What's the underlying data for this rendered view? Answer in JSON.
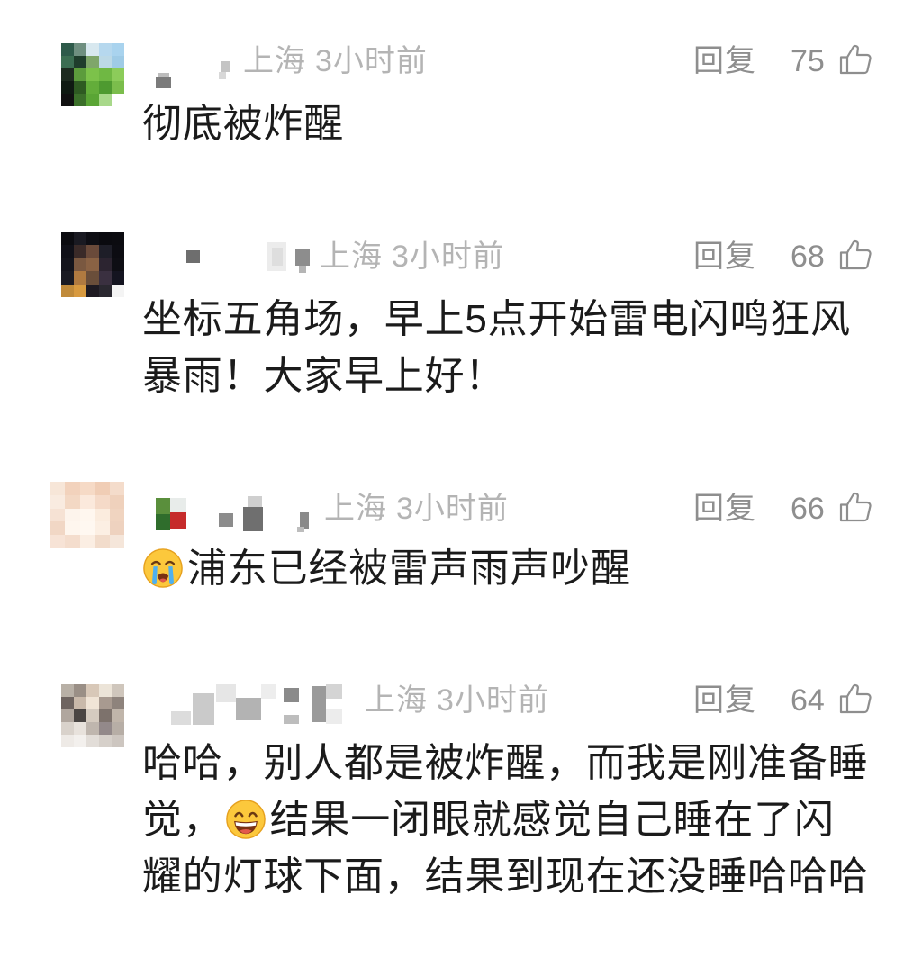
{
  "colors": {
    "text": "#1b1b1b",
    "meta": "#b4b4b4",
    "action": "#8e8e8e",
    "background": "#ffffff"
  },
  "comments": [
    {
      "avatar_colors": [
        "#2e5a4a",
        "#6f8f80",
        "#d8e8ef",
        "#b6d8ee",
        "#a9d3ee",
        "#3c6e52",
        "#1f3d2c",
        "#7fa66a",
        "#bcd9e6",
        "#9fcbe6",
        "#1d2b1f",
        "#5c9c3c",
        "#7cc24a",
        "#6fb843",
        "#8ccc5a",
        "#0f1a12",
        "#2e5a22",
        "#63ad3a",
        "#4e9a30",
        "#7bbd4c",
        "#111111",
        "#3b6f2a",
        "#5aa535",
        "#a8d88a",
        "#ffffff"
      ],
      "location": "上海",
      "time": "3小时前",
      "reply_label": "回复",
      "likes": "75",
      "like_icon": "thumbs-up-icon",
      "lines": [
        [
          {
            "text": "彻底被炸醒"
          }
        ]
      ]
    },
    {
      "avatar_colors": [
        "#0b0b10",
        "#1a1a22",
        "#0e0e14",
        "#0a0a0f",
        "#0b0b10",
        "#101018",
        "#3a2a28",
        "#6a4a3a",
        "#1e1e28",
        "#0c0c12",
        "#14141c",
        "#7a5840",
        "#8a6244",
        "#2c2430",
        "#0e0e14",
        "#1a1a22",
        "#b07a40",
        "#6a4e3a",
        "#3a3040",
        "#141420",
        "#c08a3a",
        "#d89a40",
        "#1e1a22",
        "#2a2830",
        "#f4f4f4"
      ],
      "location": "上海",
      "time": "3小时前",
      "reply_label": "回复",
      "likes": "68",
      "like_icon": "thumbs-up-icon",
      "lines": [
        [
          {
            "text": "坐标五角场，早上5点开始雷电闪鸣狂风"
          }
        ],
        [
          {
            "text": "暴雨！大家早上好！"
          }
        ]
      ]
    },
    {
      "avatar_colors": [
        "#f7e6d8",
        "#f2d2bc",
        "#f6dac6",
        "#f0cdb5",
        "#f4dccb",
        "#f9ebe0",
        "#f3d8c4",
        "#fbe9dc",
        "#f5dac8",
        "#efd1bc",
        "#f6e2d4",
        "#fdf4ec",
        "#fff7ef",
        "#fbecde",
        "#f0d4c0",
        "#f1d7c5",
        "#fef6ee",
        "#fff8f1",
        "#fcefe3",
        "#eed2bf",
        "#f7e3d6",
        "#f4ddcd",
        "#fbeee3",
        "#f2dccb",
        "#f5e6da"
      ],
      "location": "上海",
      "time": "3小时前",
      "reply_label": "回复",
      "likes": "66",
      "like_icon": "thumbs-up-icon",
      "lines": [
        [
          {
            "emoji": "crying-face-emoji"
          },
          {
            "text": "浦东已经被雷声雨声吵醒"
          }
        ]
      ]
    },
    {
      "avatar_colors": [
        "#b8b0a6",
        "#9a8f86",
        "#d8c8b8",
        "#ece4d8",
        "#cfc6bc",
        "#6e6460",
        "#c9b9aa",
        "#f0e4d6",
        "#a89a90",
        "#8e837c",
        "#b0a69e",
        "#4a4543",
        "#d5cbc0",
        "#7d726c",
        "#c0b5aa",
        "#d9d2cb",
        "#e8e2dc",
        "#bfb6ae",
        "#93898a",
        "#b7aea6",
        "#eeeae6",
        "#f3f0ed",
        "#e2ddd8",
        "#d6d0ca",
        "#cdc6c0"
      ],
      "location": "上海",
      "time": "3小时前",
      "reply_label": "回复",
      "likes": "64",
      "like_icon": "thumbs-up-icon",
      "lines": [
        [
          {
            "text": "哈哈，别人都是被炸醒，而我是刚准备睡"
          }
        ],
        [
          {
            "text": "觉，"
          },
          {
            "emoji": "grinning-face-emoji"
          },
          {
            "text": "结果一闭眼就感觉自己睡在了闪"
          }
        ],
        [
          {
            "text": "耀的灯球下面，结果到现在还没睡哈哈哈"
          }
        ]
      ]
    }
  ]
}
